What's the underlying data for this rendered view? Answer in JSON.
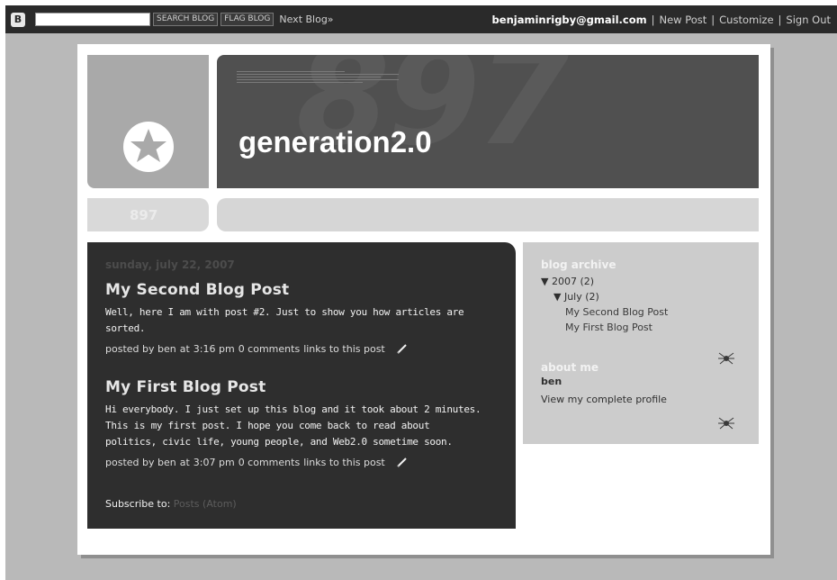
{
  "navbar": {
    "search_button": "SEARCH BLOG",
    "flag_button": "FLAG BLOG",
    "next_blog": "Next Blog»",
    "email": "benjaminrigby@gmail.com",
    "separator": "|",
    "new_post": "New Post",
    "customize": "Customize",
    "sign_out": "Sign Out"
  },
  "header": {
    "title": "generation2.0",
    "watermark": "897",
    "number_tab": "897"
  },
  "main": {
    "date": "sunday, july 22, 2007",
    "posts": [
      {
        "title": "My Second Blog Post",
        "body": [
          "Well, here I am with post #2. Just to show you how articles are sorted."
        ],
        "footer": {
          "posted_by": "posted by ben",
          "at": "at",
          "time": "3:16 pm",
          "comments": "0 comments",
          "links": "links to this post"
        }
      },
      {
        "title": "My First Blog Post",
        "body": [
          "Hi everybody. I just set up this blog and it took about 2 minutes.",
          "This is my first post. I hope you come back to read about",
          "politics, civic life, young people, and Web2.0 sometime soon."
        ],
        "footer": {
          "posted_by": "posted by ben",
          "at": "at",
          "time": "3:07 pm",
          "comments": "0 comments",
          "links": "links to this post"
        }
      }
    ],
    "subscribe_label": "Subscribe to:",
    "subscribe_link": "Posts (Atom)"
  },
  "sidebar": {
    "archive_title": "blog archive",
    "year": "▼ 2007 (2)",
    "month": "▼ July (2)",
    "archive_posts": [
      "My Second Blog Post",
      "My First Blog Post"
    ],
    "about_title": "about me",
    "profile_name": "ben",
    "profile_link": "View my complete profile"
  },
  "colors": {
    "navbar_bg": "#2a2a2a",
    "backdrop": "#b9b9b9",
    "header_bg": "#505050",
    "main_bg": "#2e2e2e",
    "sidebar_bg": "#cccccc"
  },
  "icons": {
    "logo": "blogger-logo-icon",
    "star": "star-icon",
    "pencil": "pencil-icon",
    "spider": "spider-icon"
  }
}
